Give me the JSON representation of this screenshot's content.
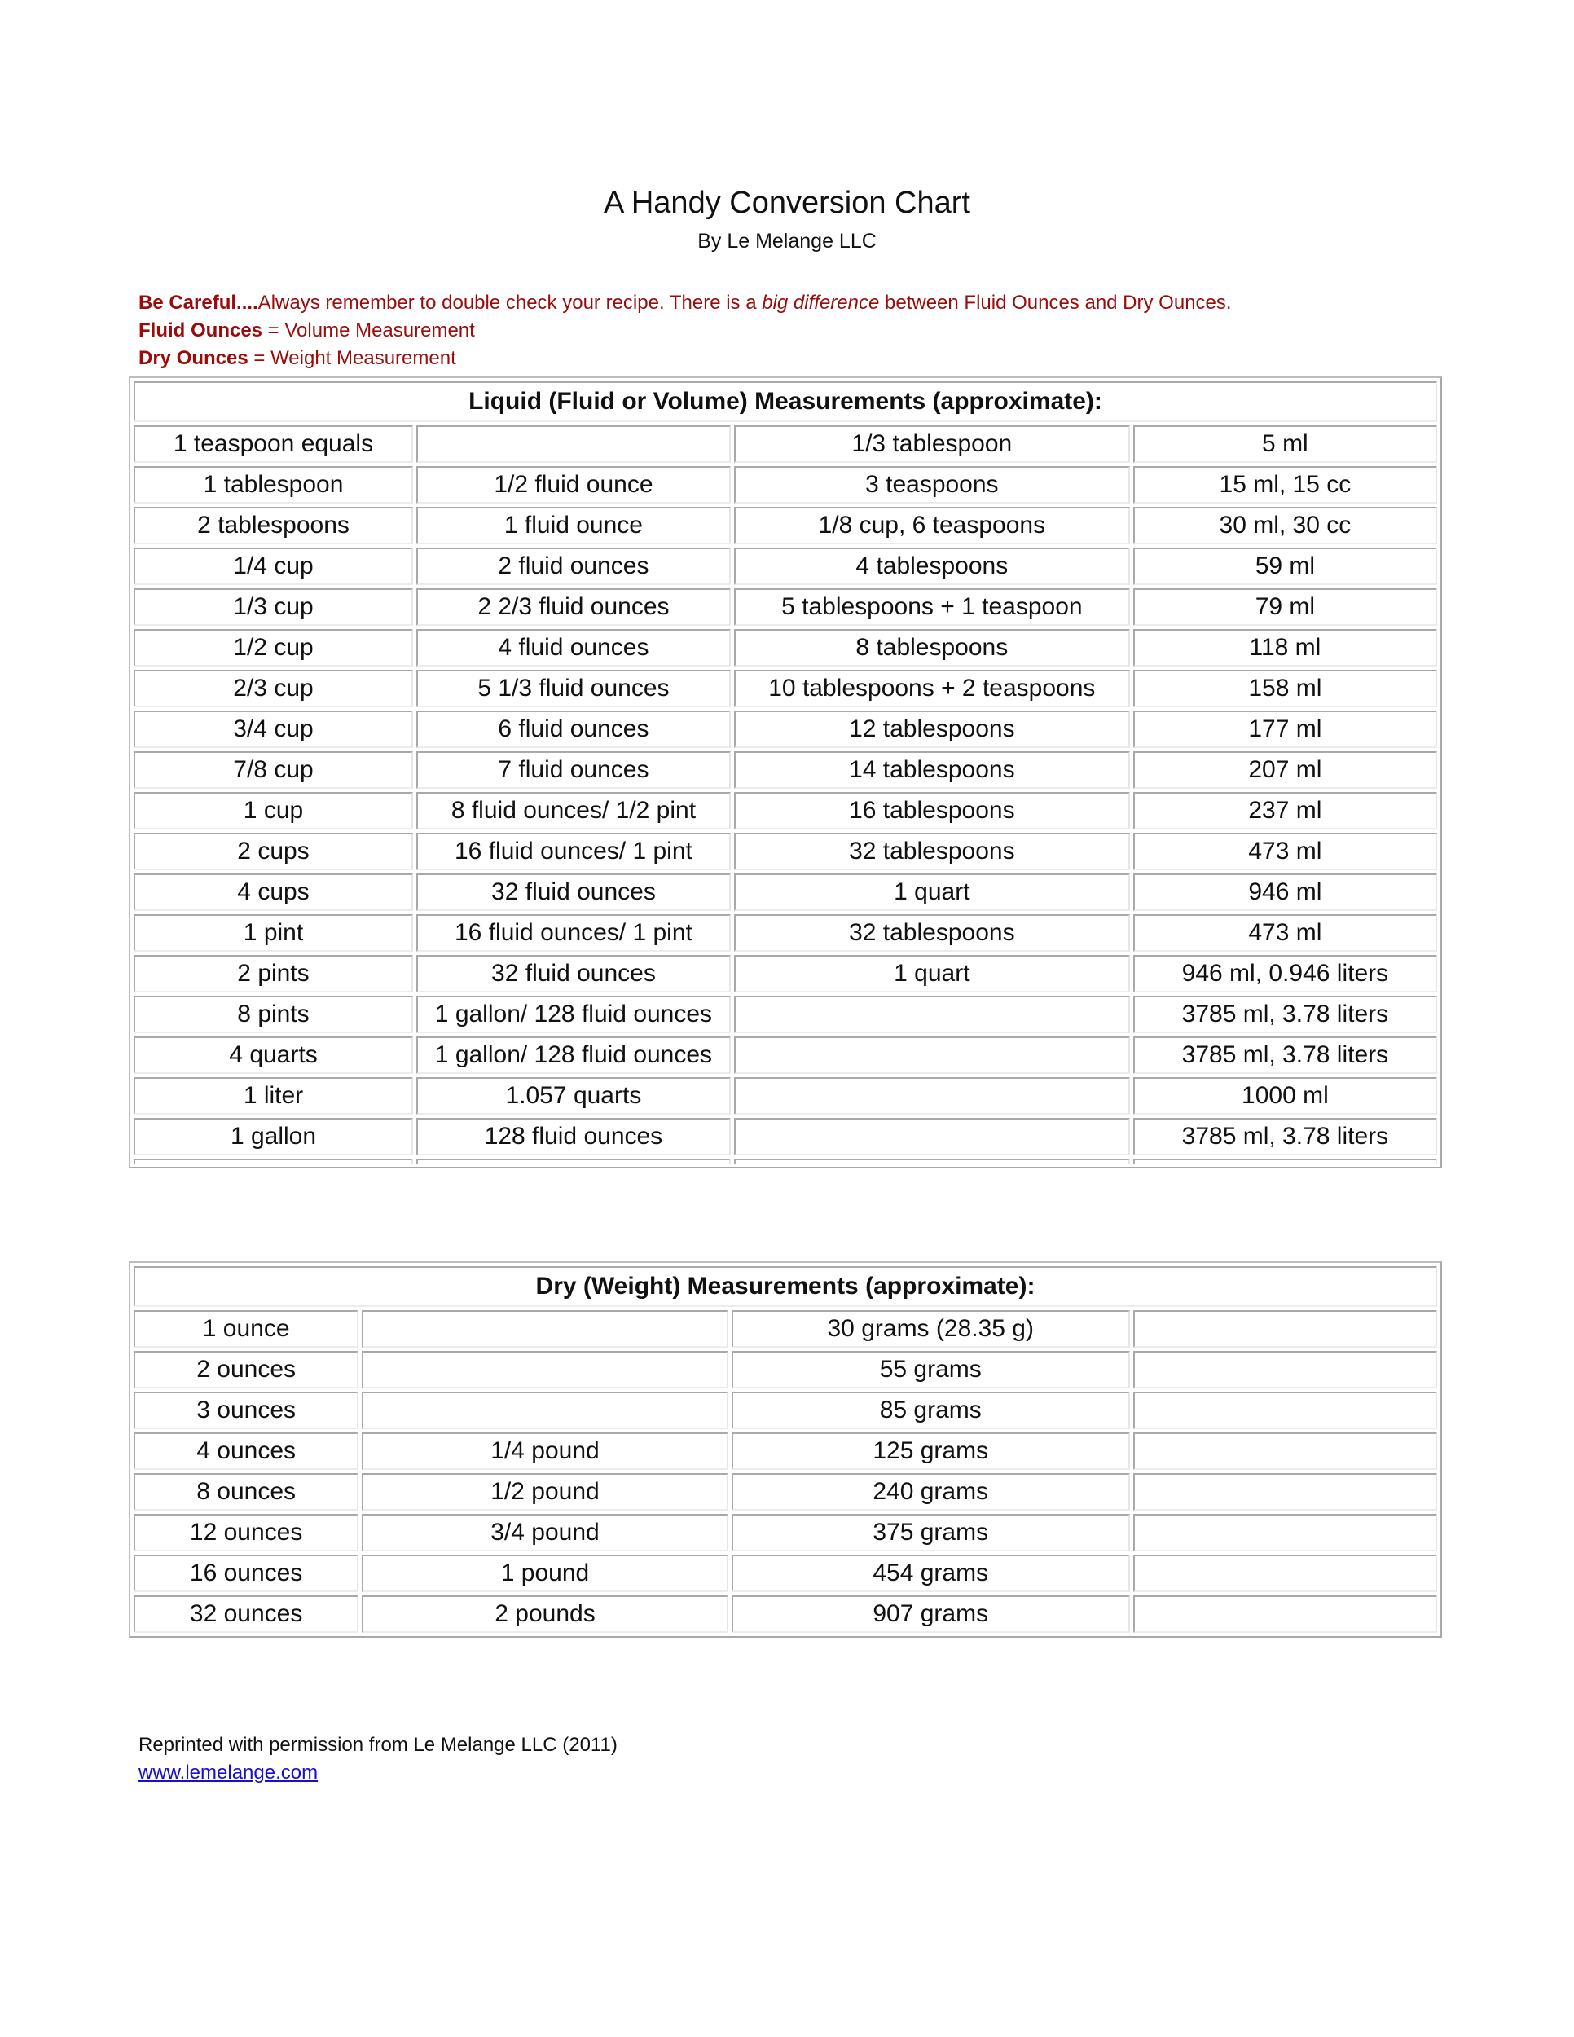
{
  "header": {
    "title": "A Handy Conversion Chart",
    "subtitle": "By Le Melange LLC"
  },
  "notes": {
    "careful_bold": "Be Careful....",
    "careful_text_1": "Always remember to double check your recipe. There is a ",
    "careful_italic": "big difference",
    "careful_text_2": " between Fluid Ounces and Dry Ounces.",
    "fluid_bold": "Fluid Ounces",
    "fluid_text": " = Volume Measurement",
    "dry_bold": "Dry Ounces",
    "dry_text": " = Weight Measurement"
  },
  "colors": {
    "note_red": "#9a0c0c",
    "link_blue": "#1a0dcc",
    "border_gray": "#a9a9a9"
  },
  "liquid": {
    "heading": "Liquid (Fluid or Volume) Measurements (approximate):",
    "rows": [
      [
        "1 teaspoon equals",
        "",
        "1/3 tablespoon",
        "5 ml"
      ],
      [
        "1 tablespoon",
        "1/2 fluid ounce",
        "3 teaspoons",
        "15 ml, 15 cc"
      ],
      [
        "2 tablespoons",
        "1 fluid ounce",
        "1/8 cup, 6 teaspoons",
        "30 ml, 30 cc"
      ],
      [
        "1/4 cup",
        "2 fluid ounces",
        "4 tablespoons",
        "59 ml"
      ],
      [
        "1/3 cup",
        "2 2/3 fluid ounces",
        "5 tablespoons + 1 teaspoon",
        "79 ml"
      ],
      [
        "1/2 cup",
        "4 fluid ounces",
        "8 tablespoons",
        "118 ml"
      ],
      [
        "2/3 cup",
        "5 1/3 fluid ounces",
        "10 tablespoons + 2 teaspoons",
        "158 ml"
      ],
      [
        "3/4 cup",
        "6 fluid ounces",
        "12 tablespoons",
        "177 ml"
      ],
      [
        "7/8 cup",
        "7 fluid ounces",
        "14 tablespoons",
        "207 ml"
      ],
      [
        "1 cup",
        "8 fluid ounces/ 1/2 pint",
        "16 tablespoons",
        "237 ml"
      ],
      [
        "2 cups",
        "16 fluid ounces/ 1 pint",
        "32 tablespoons",
        "473 ml"
      ],
      [
        "4 cups",
        "32 fluid ounces",
        "1 quart",
        "946 ml"
      ],
      [
        "1 pint",
        "16 fluid ounces/ 1 pint",
        "32 tablespoons",
        "473 ml"
      ],
      [
        "2 pints",
        "32 fluid ounces",
        "1 quart",
        "946 ml, 0.946 liters"
      ],
      [
        "8 pints",
        "1 gallon/ 128 fluid ounces",
        "",
        "3785 ml, 3.78 liters"
      ],
      [
        "4 quarts",
        "1 gallon/ 128 fluid ounces",
        "",
        "3785 ml, 3.78 liters"
      ],
      [
        "1 liter",
        "1.057 quarts",
        "",
        "1000 ml"
      ],
      [
        "1 gallon",
        "128 fluid ounces",
        "",
        "3785 ml, 3.78 liters"
      ]
    ]
  },
  "dry": {
    "heading": "Dry (Weight) Measurements (approximate):",
    "rows": [
      [
        "1 ounce",
        "",
        "30 grams (28.35 g)",
        ""
      ],
      [
        "2 ounces",
        "",
        "55 grams",
        ""
      ],
      [
        "3 ounces",
        "",
        "85 grams",
        ""
      ],
      [
        "4 ounces",
        "1/4 pound",
        "125 grams",
        ""
      ],
      [
        "8 ounces",
        "1/2 pound",
        "240 grams",
        ""
      ],
      [
        "12 ounces",
        "3/4 pound",
        "375 grams",
        ""
      ],
      [
        "16 ounces",
        "1 pound",
        "454 grams",
        ""
      ],
      [
        "32 ounces",
        "2 pounds",
        "907 grams",
        ""
      ]
    ]
  },
  "footer": {
    "reprint": "Reprinted with permission from Le Melange LLC (2011)",
    "link": "www.lemelange.com"
  }
}
